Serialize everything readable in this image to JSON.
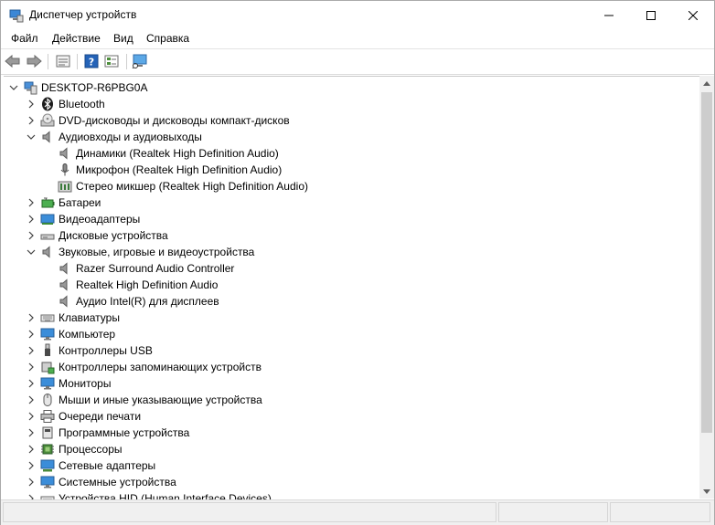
{
  "window": {
    "title": "Диспетчер устройств"
  },
  "menu": [
    {
      "label": "Файл"
    },
    {
      "label": "Действие"
    },
    {
      "label": "Вид"
    },
    {
      "label": "Справка"
    }
  ],
  "toolbar": {
    "buttons": [
      "back-icon",
      "forward-icon",
      "properties-icon",
      "help-icon",
      "view-icon",
      "scan-hardware-icon"
    ]
  },
  "tree": [
    {
      "label": "DESKTOP-R6PBG0A",
      "level": 0,
      "expander": "expanded",
      "icon": "computer-icon"
    },
    {
      "label": "Bluetooth",
      "level": 1,
      "expander": "collapsed",
      "icon": "bluetooth-icon"
    },
    {
      "label": "DVD-дисководы и дисководы компакт-дисков",
      "level": 1,
      "expander": "collapsed",
      "icon": "dvd-drive-icon"
    },
    {
      "label": "Аудиовходы и аудиовыходы",
      "level": 1,
      "expander": "expanded",
      "icon": "speaker-icon"
    },
    {
      "label": "Динамики (Realtek High Definition Audio)",
      "level": 2,
      "expander": "none",
      "icon": "speaker-icon"
    },
    {
      "label": "Микрофон (Realtek High Definition Audio)",
      "level": 2,
      "expander": "none",
      "icon": "microphone-icon"
    },
    {
      "label": "Стерео микшер (Realtek High Definition Audio)",
      "level": 2,
      "expander": "none",
      "icon": "mixer-icon"
    },
    {
      "label": "Батареи",
      "level": 1,
      "expander": "collapsed",
      "icon": "battery-icon"
    },
    {
      "label": "Видеоадаптеры",
      "level": 1,
      "expander": "collapsed",
      "icon": "display-adapter-icon"
    },
    {
      "label": "Дисковые устройства",
      "level": 1,
      "expander": "collapsed",
      "icon": "disk-drive-icon"
    },
    {
      "label": "Звуковые, игровые и видеоустройства",
      "level": 1,
      "expander": "expanded",
      "icon": "speaker-icon"
    },
    {
      "label": "Razer Surround Audio Controller",
      "level": 2,
      "expander": "none",
      "icon": "speaker-icon"
    },
    {
      "label": "Realtek High Definition Audio",
      "level": 2,
      "expander": "none",
      "icon": "speaker-icon"
    },
    {
      "label": "Аудио Intel(R) для дисплеев",
      "level": 2,
      "expander": "none",
      "icon": "speaker-icon"
    },
    {
      "label": "Клавиатуры",
      "level": 1,
      "expander": "collapsed",
      "icon": "keyboard-icon"
    },
    {
      "label": "Компьютер",
      "level": 1,
      "expander": "collapsed",
      "icon": "monitor-icon"
    },
    {
      "label": "Контроллеры USB",
      "level": 1,
      "expander": "collapsed",
      "icon": "usb-icon"
    },
    {
      "label": "Контроллеры запоминающих устройств",
      "level": 1,
      "expander": "collapsed",
      "icon": "storage-controller-icon"
    },
    {
      "label": "Мониторы",
      "level": 1,
      "expander": "collapsed",
      "icon": "monitor-icon"
    },
    {
      "label": "Мыши и иные указывающие устройства",
      "level": 1,
      "expander": "collapsed",
      "icon": "mouse-icon"
    },
    {
      "label": "Очереди печати",
      "level": 1,
      "expander": "collapsed",
      "icon": "printer-icon"
    },
    {
      "label": "Программные устройства",
      "level": 1,
      "expander": "collapsed",
      "icon": "software-device-icon"
    },
    {
      "label": "Процессоры",
      "level": 1,
      "expander": "collapsed",
      "icon": "cpu-icon"
    },
    {
      "label": "Сетевые адаптеры",
      "level": 1,
      "expander": "collapsed",
      "icon": "network-adapter-icon"
    },
    {
      "label": "Системные устройства",
      "level": 1,
      "expander": "collapsed",
      "icon": "system-device-icon"
    },
    {
      "label": "Устройства HID (Human Interface Devices)",
      "level": 1,
      "expander": "collapsed",
      "icon": "hid-icon"
    }
  ],
  "colors": {
    "window_bg": "#ffffff",
    "chrome_bg": "#f0f0f0",
    "icon_blue": "#2f78c8"
  }
}
